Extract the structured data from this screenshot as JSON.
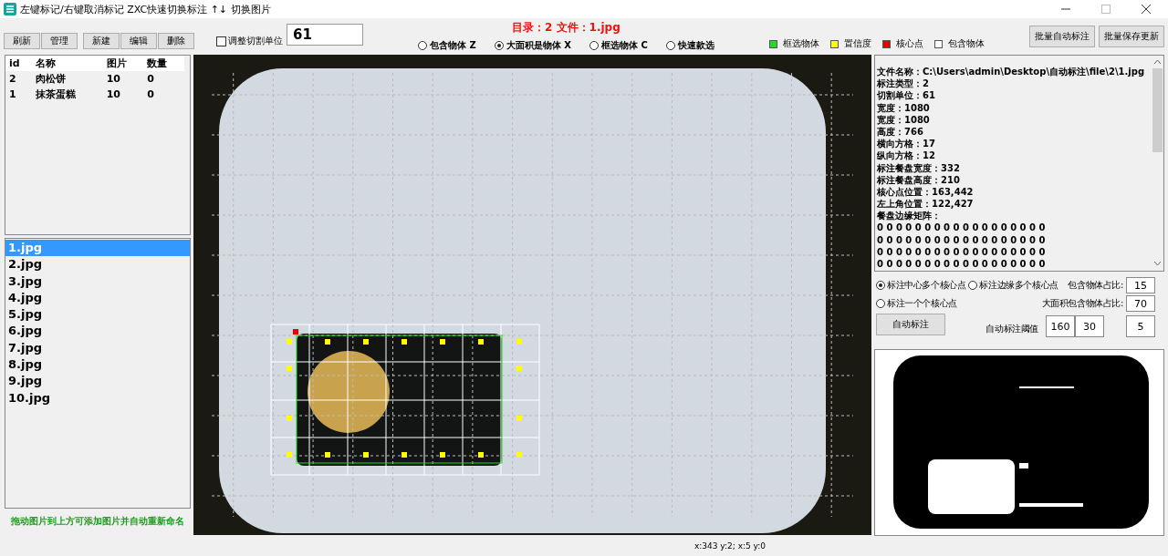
{
  "window": {
    "title": "左键标记/右键取消标记  ZXC快速切换标注  ↑↓ 切换图片"
  },
  "toolbar": {
    "button_groups": [
      [
        "刷新",
        "管理"
      ],
      [
        "新建",
        "编辑",
        "删除"
      ]
    ],
    "adjust_checkbox": {
      "label": "调整切割单位",
      "checked": false
    },
    "unit_value": "61",
    "heading": "目录：2  文件：1.jpg",
    "modes": [
      {
        "label": "包含物体 Z",
        "selected": false
      },
      {
        "label": "大面积是物体 X",
        "selected": true
      },
      {
        "label": "框选物体 C",
        "selected": false
      },
      {
        "label": "快速款选",
        "selected": false
      }
    ],
    "legend": [
      {
        "label": "框选物体",
        "color": "#22dd22"
      },
      {
        "label": "置信度",
        "color": "#ffff00"
      },
      {
        "label": "核心点",
        "color": "#ee0000"
      },
      {
        "label": "包含物体",
        "color": "#ffffff"
      }
    ],
    "actions": [
      "批量自动标注",
      "批量保存更新"
    ]
  },
  "category_table": {
    "columns": [
      "id",
      "名称",
      "图片",
      "数量"
    ],
    "rows": [
      [
        "2",
        "肉松饼",
        "10",
        "0"
      ],
      [
        "1",
        "抹茶蛋糕",
        "10",
        "0"
      ]
    ]
  },
  "files": [
    {
      "name": "1.jpg",
      "selected": true
    },
    {
      "name": "2.jpg",
      "selected": false
    },
    {
      "name": "3.jpg",
      "selected": false
    },
    {
      "name": "4.jpg",
      "selected": false
    },
    {
      "name": "5.jpg",
      "selected": false
    },
    {
      "name": "6.jpg",
      "selected": false
    },
    {
      "name": "7.jpg",
      "selected": false
    },
    {
      "name": "8.jpg",
      "selected": false
    },
    {
      "name": "9.jpg",
      "selected": false
    },
    {
      "name": "10.jpg",
      "selected": false
    }
  ],
  "drop_hint": "拖动图片到上方可添加图片并自动重新命名",
  "info": {
    "lines": [
      "文件名称：C:\\Users\\admin\\Desktop\\自动标注\\file\\2\\1.jpg",
      "标注类型：2",
      "切割单位：61",
      "宽度：1080",
      "宽度：1080",
      "高度：766",
      "横向方格：17",
      "纵向方格：12",
      "标注餐盘宽度：332",
      "标注餐盘高度：210",
      "核心点位置：163,442",
      "左上角位置：122,427",
      "餐盘边缘矩阵："
    ],
    "matrix_rows": [
      "0 0 0 0 0 0 0 0 0 0 0 0 0 0 0 0 0 0",
      "0 0 0 0 0 0 0 0 0 0 0 0 0 0 0 0 0 0",
      "0 0 0 0 0 0 0 0 0 0 0 0 0 0 0 0 0 0",
      "0 0 0 0 0 0 0 0 0 0 0 0 0 0 0 0 0 0"
    ]
  },
  "options": {
    "radios": [
      {
        "label": "标注中心多个核心点",
        "selected": true
      },
      {
        "label": "标注边缘多个核心点",
        "selected": false
      },
      {
        "label": "标注一个个核心点",
        "selected": false
      }
    ],
    "ratios": [
      {
        "label": "包含物体占比:",
        "value": "15"
      },
      {
        "label": "大面积包含物体占比:",
        "value": "70"
      }
    ],
    "auto_button": "自动标注",
    "threshold_label": "自动标注阈值",
    "threshold_values": [
      "160",
      "30"
    ],
    "extra_value": "5"
  },
  "status_bar": "x:343  y:2;  x:5  y:0"
}
